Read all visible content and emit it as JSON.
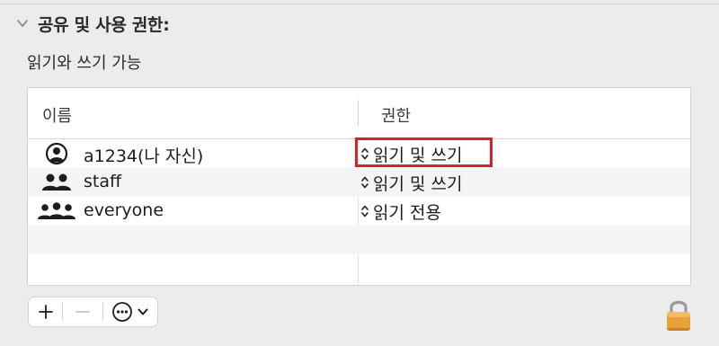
{
  "section": {
    "title": "공유 및 사용 권한:",
    "access_summary": "읽기와 쓰기 가능"
  },
  "table": {
    "columns": [
      "이름",
      "권한"
    ],
    "rows": [
      {
        "name": "a1234(나 자신)",
        "icon": "single-user-circle-icon",
        "permission": "읽기 및 쓰기",
        "highlighted": true
      },
      {
        "name": "staff",
        "icon": "group-icon",
        "permission": "읽기 및 쓰기",
        "highlighted": false
      },
      {
        "name": "everyone",
        "icon": "everyone-icon",
        "permission": "읽기 전용",
        "highlighted": false
      }
    ]
  },
  "toolbar": {
    "add_icon": "plus-icon",
    "remove_icon": "minus-icon",
    "actions_icon": "ellipsis-circle-icon",
    "actions_menu_icon": "chevron-down-icon"
  },
  "lock_icon": "lock-icon",
  "colors": {
    "highlight": "#d9202a",
    "lock": "#e8a23a"
  }
}
